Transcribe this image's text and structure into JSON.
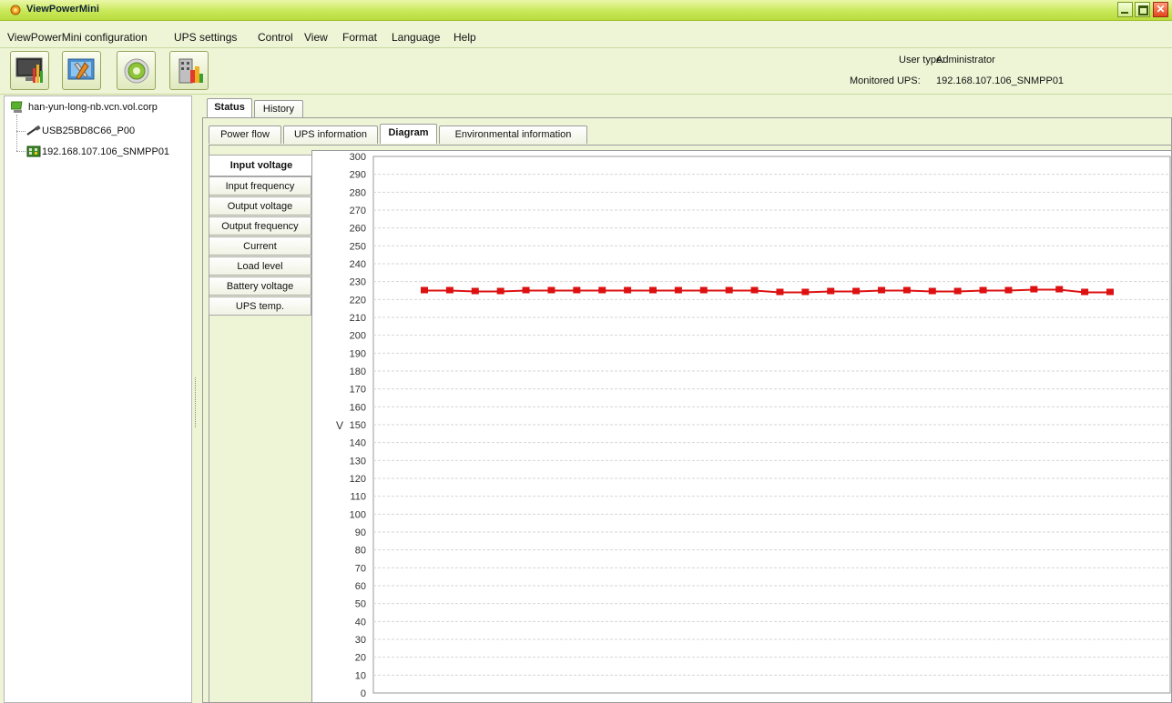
{
  "window": {
    "title": "ViewPowerMini"
  },
  "menu": {
    "items": [
      "ViewPowerMini",
      "configuration",
      "UPS settings",
      "Control",
      "View",
      "Format",
      "Language",
      "Help"
    ]
  },
  "toolbar": {
    "buttons": [
      {
        "icon": "monitor-chart-icon"
      },
      {
        "icon": "tools-icon"
      },
      {
        "icon": "gear-disc-icon"
      },
      {
        "icon": "building-report-icon"
      }
    ],
    "user_type_label": "User type:",
    "user_type_value": "Administrator",
    "monitored_label": "Monitored UPS:",
    "monitored_value": "192.168.107.106_SNMPP01"
  },
  "tree": {
    "root": "han-yun-long-nb.vcn.vol.corp",
    "children": [
      "USB25BD8C66_P00",
      "192.168.107.106_SNMPP01"
    ]
  },
  "tabs": {
    "top": [
      "Status",
      "History"
    ],
    "top_active": "Status",
    "sub": [
      "Power flow",
      "UPS information",
      "Diagram",
      "Environmental information"
    ],
    "sub_active": "Diagram",
    "diagram": [
      "Input voltage",
      "Input frequency",
      "Output voltage",
      "Output frequency",
      "Current",
      "Load level",
      "Battery voltage",
      "UPS temp."
    ],
    "diagram_active": "Input voltage"
  },
  "chart_data": {
    "type": "line",
    "ylabel": "V",
    "ylim": [
      0,
      300
    ],
    "ytick_step": 10,
    "grid": true,
    "series_color": "#dd1111",
    "values": [
      225,
      225,
      224.5,
      224.5,
      225,
      225,
      225,
      225,
      225,
      225,
      225,
      225,
      225,
      225,
      224,
      224,
      224.5,
      224.5,
      225,
      225,
      224.5,
      224.5,
      225,
      225,
      225.5,
      225.5,
      224,
      224
    ]
  },
  "colors": {
    "accent": "#c9e85a",
    "background": "#eef5d6",
    "series": "#dd1111"
  }
}
